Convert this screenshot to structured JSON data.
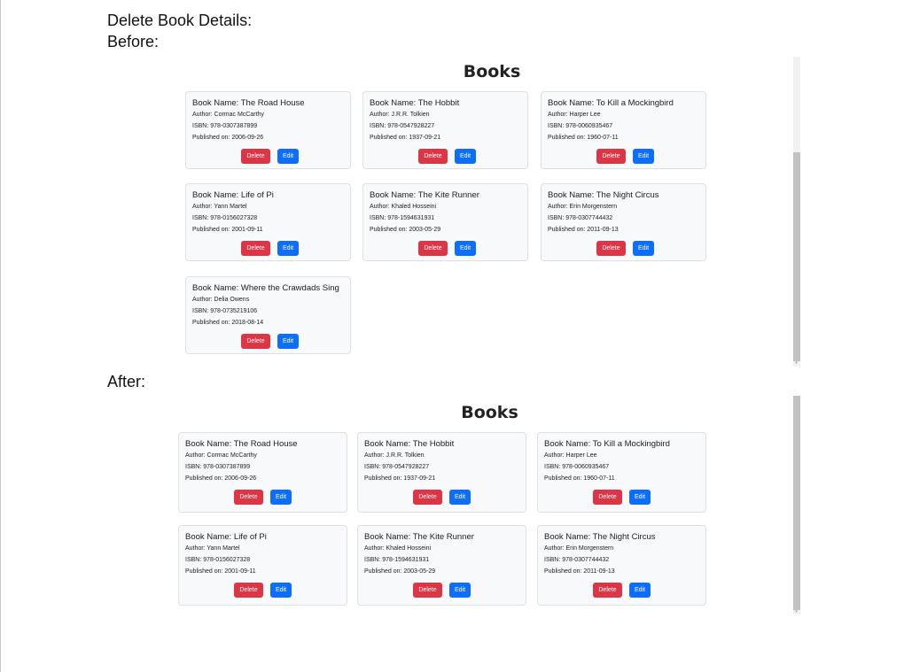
{
  "page": {
    "heading": "Delete Book Details:",
    "before_label": "Before:",
    "after_label": "After:"
  },
  "before": {
    "title": "Books",
    "books": [
      {
        "name": "Book Name: The Road House",
        "author": "Author: Cormac McCarthy",
        "isbn": "ISBN: 978-0307387899",
        "published": "Published on: 2006-09-26",
        "delete_label": "Delete",
        "edit_label": "Edit"
      },
      {
        "name": "Book Name: The Hobbit",
        "author": "Author: J.R.R. Tolkien",
        "isbn": "ISBN: 978-0547928227",
        "published": "Published on: 1937-09-21",
        "delete_label": "Delete",
        "edit_label": "Edit"
      },
      {
        "name": "Book Name: To Kill a Mockingbird",
        "author": "Author: Harper Lee",
        "isbn": "ISBN: 978-0060935467",
        "published": "Published on: 1960-07-11",
        "delete_label": "Delete",
        "edit_label": "Edit"
      },
      {
        "name": "Book Name: Life of Pi",
        "author": "Author: Yann Martel",
        "isbn": "ISBN: 978-0156027328",
        "published": "Published on: 2001-09-11",
        "delete_label": "Delete",
        "edit_label": "Edit"
      },
      {
        "name": "Book Name: The Kite Runner",
        "author": "Author: Khaled Hosseini",
        "isbn": "ISBN: 978-1594631931",
        "published": "Published on: 2003-05-29",
        "delete_label": "Delete",
        "edit_label": "Edit"
      },
      {
        "name": "Book Name: The Night Circus",
        "author": "Author: Erin Morgenstern",
        "isbn": "ISBN: 978-0307744432",
        "published": "Published on: 2011-09-13",
        "delete_label": "Delete",
        "edit_label": "Edit"
      },
      {
        "name": "Book Name: Where the Crawdads Sing",
        "author": "Author: Delia Owens",
        "isbn": "ISBN: 978-0735219106",
        "published": "Published on: 2018-08-14",
        "delete_label": "Delete",
        "edit_label": "Edit"
      }
    ]
  },
  "after": {
    "title": "Books",
    "books": [
      {
        "name": "Book Name: The Road House",
        "author": "Author: Cormac McCarthy",
        "isbn": "ISBN: 978-0307387899",
        "published": "Published on: 2006-09-26",
        "delete_label": "Delete",
        "edit_label": "Edit"
      },
      {
        "name": "Book Name: The Hobbit",
        "author": "Author: J.R.R. Tolkien",
        "isbn": "ISBN: 978-0547928227",
        "published": "Published on: 1937-09-21",
        "delete_label": "Delete",
        "edit_label": "Edit"
      },
      {
        "name": "Book Name: To Kill a Mockingbird",
        "author": "Author: Harper Lee",
        "isbn": "ISBN: 978-0060935467",
        "published": "Published on: 1960-07-11",
        "delete_label": "Delete",
        "edit_label": "Edit"
      },
      {
        "name": "Book Name: Life of Pi",
        "author": "Author: Yann Martel",
        "isbn": "ISBN: 978-0156027328",
        "published": "Published on: 2001-09-11",
        "delete_label": "Delete",
        "edit_label": "Edit"
      },
      {
        "name": "Book Name: The Kite Runner",
        "author": "Author: Khaled Hosseini",
        "isbn": "ISBN: 978-1594631931",
        "published": "Published on: 2003-05-29",
        "delete_label": "Delete",
        "edit_label": "Edit"
      },
      {
        "name": "Book Name: The Night Circus",
        "author": "Author: Erin Morgenstern",
        "isbn": "ISBN: 978-0307744432",
        "published": "Published on: 2011-09-13",
        "delete_label": "Delete",
        "edit_label": "Edit"
      }
    ]
  },
  "colors": {
    "delete_button": "#dc3545",
    "edit_button": "#0d6efd",
    "card_background": "#f8f9fa"
  }
}
